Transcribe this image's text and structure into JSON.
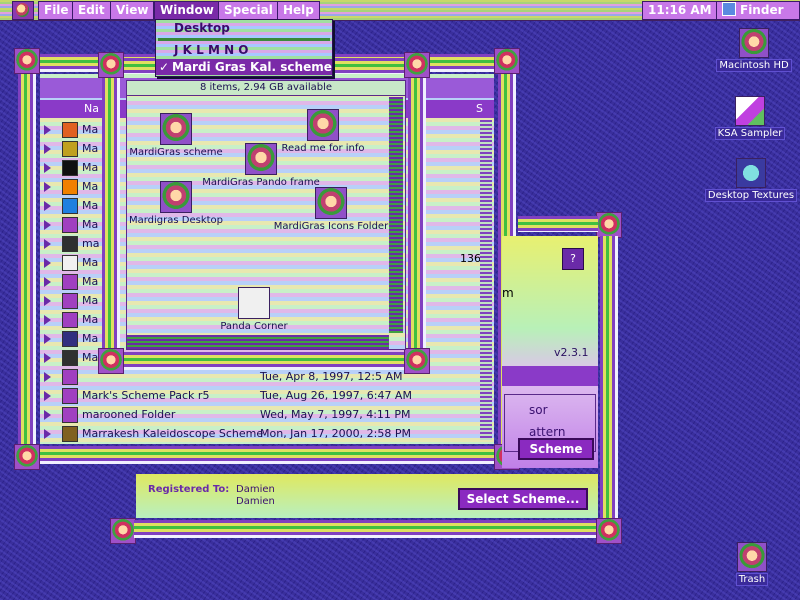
{
  "menubar": {
    "menus": [
      "File",
      "Edit",
      "View",
      "Window",
      "Special",
      "Help"
    ],
    "clock": "11:16 AM",
    "app": "Finder"
  },
  "window_menu": {
    "items": [
      "Desktop",
      "J K L M N O",
      "Mardi Gras Kal. scheme"
    ],
    "checkmark": "✓"
  },
  "list_window": {
    "column_header_name": "Na",
    "column_header_size": "S",
    "visible_size": "136",
    "rows": [
      {
        "name": "Ma",
        "date": ""
      },
      {
        "name": "Ma",
        "date": ""
      },
      {
        "name": "Ma",
        "date": ""
      },
      {
        "name": "Ma",
        "date": ""
      },
      {
        "name": "Ma",
        "date": ""
      },
      {
        "name": "Ma",
        "date": ""
      },
      {
        "name": "ma",
        "date": ""
      },
      {
        "name": "Ma",
        "date": ""
      },
      {
        "name": "Ma",
        "date": ""
      },
      {
        "name": "Ma",
        "date": ""
      },
      {
        "name": "Ma",
        "date": ""
      },
      {
        "name": "Ma",
        "date": ""
      },
      {
        "name": "Ma",
        "date": ""
      },
      {
        "name": "",
        "date": "Tue, Apr 8, 1997, 12:5 AM"
      },
      {
        "name": "Mark's Scheme Pack r5",
        "date": "Tue, Aug 26, 1997, 6:47 AM"
      },
      {
        "name": "marooned Folder",
        "date": "Wed, May 7, 1997, 4:11 PM"
      },
      {
        "name": "Marrakesh Kaleidoscope Scheme",
        "date": "Mon, Jan 17, 2000, 2:58 PM"
      }
    ]
  },
  "icon_window": {
    "status": "8 items, 2.94 GB available",
    "icons": [
      {
        "label": "MardiGras scheme"
      },
      {
        "label": "Read me for info"
      },
      {
        "label": "MardiGras Pando frame"
      },
      {
        "label": "Mardigras Desktop"
      },
      {
        "label": "MardiGras Icons Folder"
      },
      {
        "label": "Panda Corner"
      }
    ]
  },
  "scheme_window": {
    "version": "v2.3.1",
    "partial_title_char": "m",
    "partial_text_1": "sor",
    "partial_text_2": "attern",
    "scheme_button": "Scheme",
    "registered_label": "Registered To:",
    "registered_name_1": "Damien",
    "registered_name_2": "Damien",
    "select_button": "Select Scheme..."
  },
  "desktop_icons": [
    {
      "label": "Macintosh HD"
    },
    {
      "label": "KSA Sampler"
    },
    {
      "label": "Desktop Textures"
    },
    {
      "label": "Trash"
    }
  ]
}
